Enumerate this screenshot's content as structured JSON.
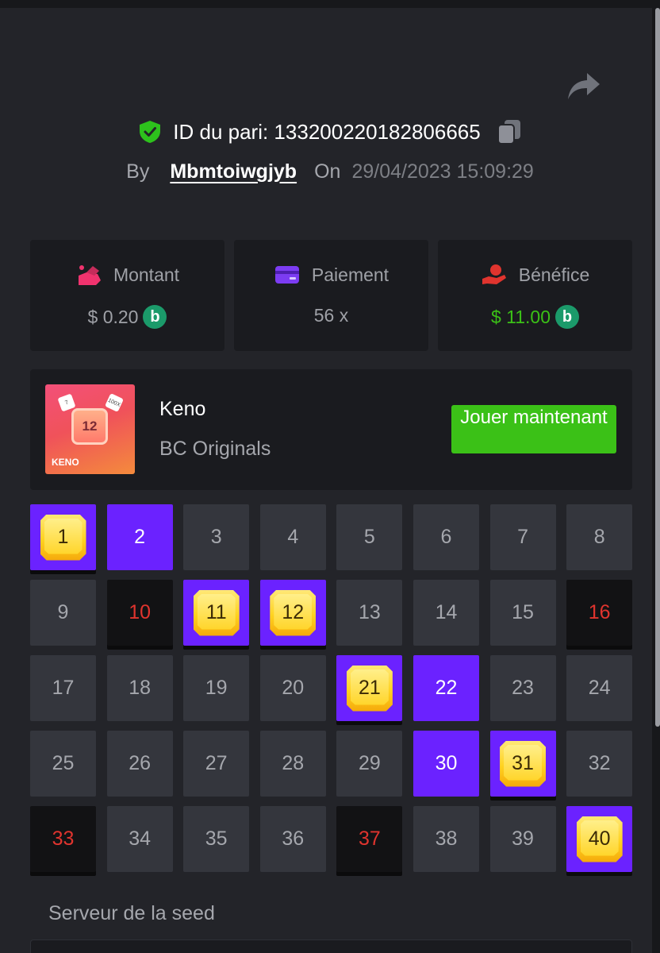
{
  "header": {
    "bet_id_text": "ID du pari: 133200220182806665",
    "by_label": "By",
    "username": "Mbmtoiwgjyb",
    "on_label": "On",
    "datetime": "29/04/2023 15:09:29"
  },
  "stats": {
    "amount": {
      "label": "Montant",
      "value": "$ 0.20",
      "icon": "bet-amount-icon"
    },
    "payout": {
      "label": "Paiement",
      "value": "56 x",
      "icon": "card-icon"
    },
    "profit": {
      "label": "Bénéfice",
      "value": "$ 11.00",
      "icon": "profit-hand-icon"
    },
    "coin_symbol": "b"
  },
  "game": {
    "title": "Keno",
    "provider": "BC Originals",
    "play_label": "Jouer maintenant",
    "thumb_tile": "12",
    "thumb_label": "KENO",
    "thumb_dice1": "7",
    "thumb_dice2": "100X"
  },
  "keno": {
    "cells": [
      {
        "n": "1",
        "state": "hit"
      },
      {
        "n": "2",
        "state": "picked"
      },
      {
        "n": "3",
        "state": "normal"
      },
      {
        "n": "4",
        "state": "normal"
      },
      {
        "n": "5",
        "state": "normal"
      },
      {
        "n": "6",
        "state": "normal"
      },
      {
        "n": "7",
        "state": "normal"
      },
      {
        "n": "8",
        "state": "normal"
      },
      {
        "n": "9",
        "state": "normal"
      },
      {
        "n": "10",
        "state": "miss"
      },
      {
        "n": "11",
        "state": "hit"
      },
      {
        "n": "12",
        "state": "hit"
      },
      {
        "n": "13",
        "state": "normal"
      },
      {
        "n": "14",
        "state": "normal"
      },
      {
        "n": "15",
        "state": "normal"
      },
      {
        "n": "16",
        "state": "miss"
      },
      {
        "n": "17",
        "state": "normal"
      },
      {
        "n": "18",
        "state": "normal"
      },
      {
        "n": "19",
        "state": "normal"
      },
      {
        "n": "20",
        "state": "normal"
      },
      {
        "n": "21",
        "state": "hit"
      },
      {
        "n": "22",
        "state": "picked"
      },
      {
        "n": "23",
        "state": "normal"
      },
      {
        "n": "24",
        "state": "normal"
      },
      {
        "n": "25",
        "state": "normal"
      },
      {
        "n": "26",
        "state": "normal"
      },
      {
        "n": "27",
        "state": "normal"
      },
      {
        "n": "28",
        "state": "normal"
      },
      {
        "n": "29",
        "state": "normal"
      },
      {
        "n": "30",
        "state": "picked"
      },
      {
        "n": "31",
        "state": "hit"
      },
      {
        "n": "32",
        "state": "normal"
      },
      {
        "n": "33",
        "state": "miss"
      },
      {
        "n": "34",
        "state": "normal"
      },
      {
        "n": "35",
        "state": "normal"
      },
      {
        "n": "36",
        "state": "normal"
      },
      {
        "n": "37",
        "state": "miss"
      },
      {
        "n": "38",
        "state": "normal"
      },
      {
        "n": "39",
        "state": "normal"
      },
      {
        "n": "40",
        "state": "hit"
      }
    ]
  },
  "seed": {
    "label": "Serveur de la seed"
  },
  "colors": {
    "accent_purple": "#6b22ff",
    "green": "#3bc117",
    "miss_red": "#e0342e",
    "gem_gold": "#ffd21f"
  }
}
